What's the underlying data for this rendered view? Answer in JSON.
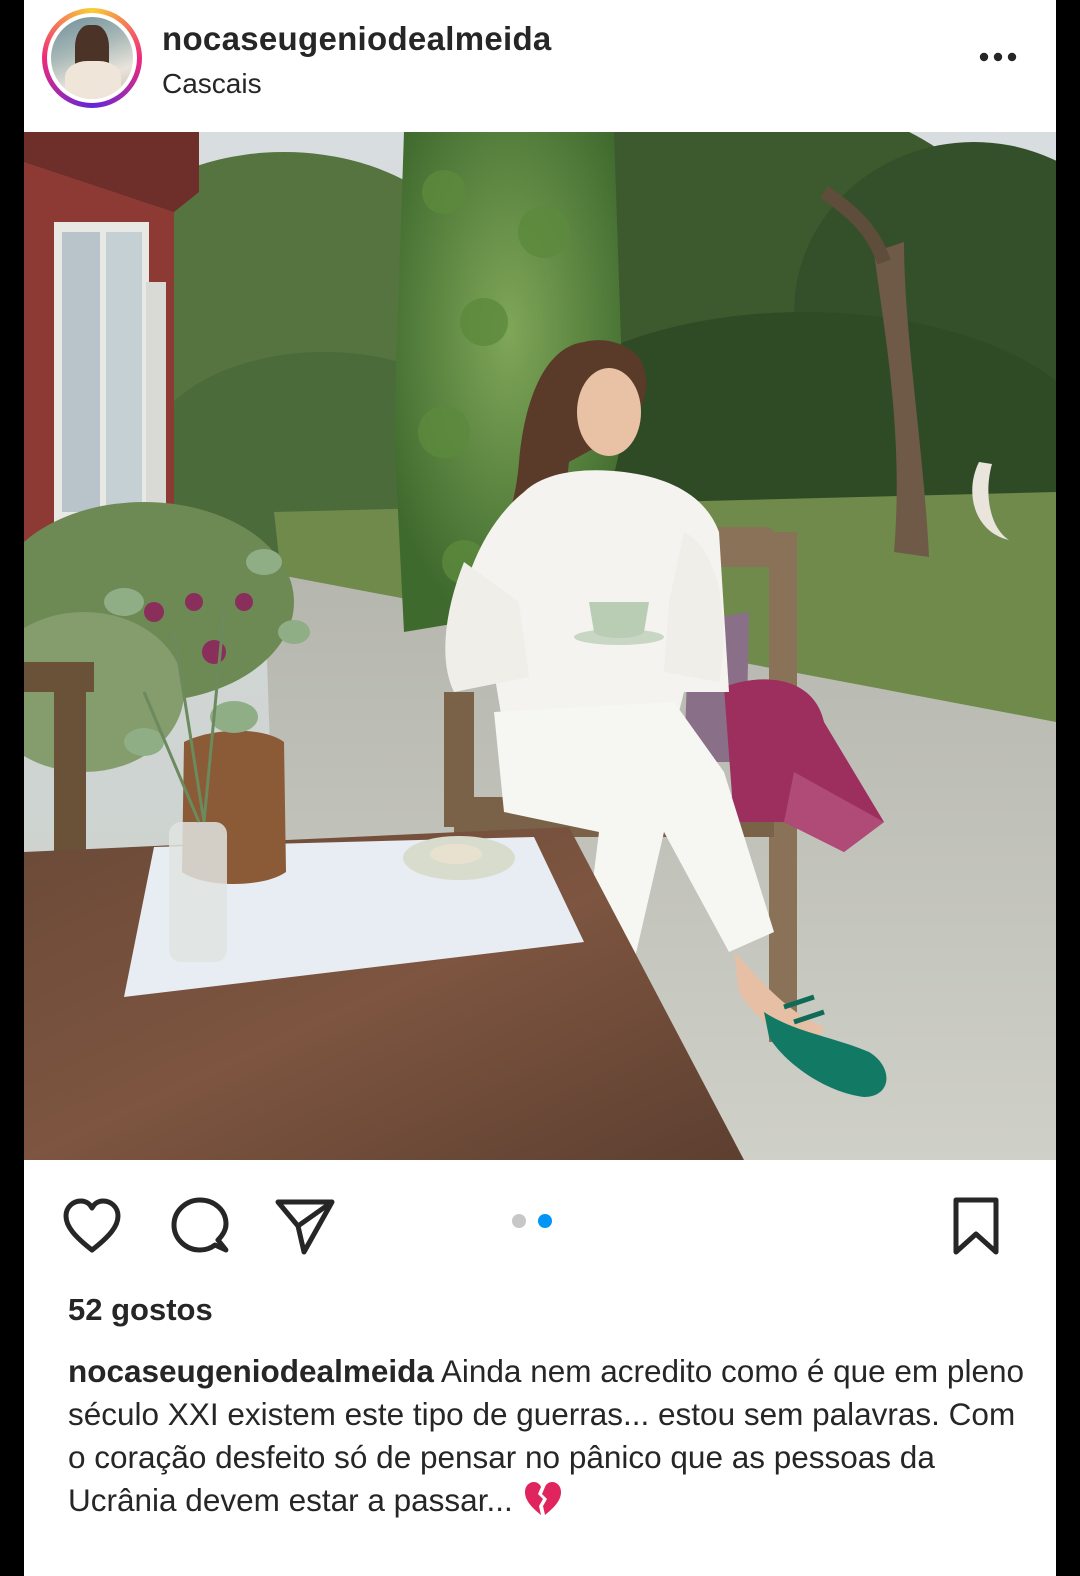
{
  "post": {
    "username": "nocaseugeniodealmeida",
    "location": "Cascais",
    "likes_text": "52 gostos",
    "caption_username": "nocaseugeniodealmeida",
    "caption_text": "Ainda nem acredito como é que em pleno século XXI existem este tipo de guerras... estou sem palavras. Com o coração desfeito só de pensar no pânico que as pessoas da Ucrânia devem estar a passar...",
    "caption_emoji": "broken-heart"
  },
  "carousel": {
    "total": 2,
    "active": 2
  },
  "icons": {
    "more": "more-options-icon",
    "like": "heart-icon",
    "comment": "comment-icon",
    "share": "send-icon",
    "save": "bookmark-icon"
  },
  "colors": {
    "carousel_active": "#0095f6",
    "carousel_inactive": "#c7c7c7",
    "text": "#262626",
    "broken_heart": "#e0245e"
  }
}
